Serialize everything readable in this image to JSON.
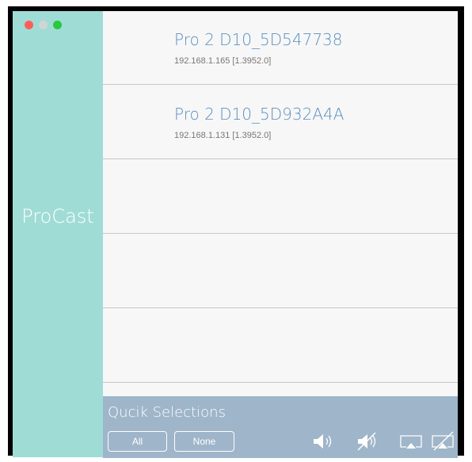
{
  "app": {
    "title": "ProCast"
  },
  "devices": [
    {
      "name": "Pro 2 D10_5D547738",
      "address": "192.168.1.165 [1.3952.0]"
    },
    {
      "name": "Pro 2 D10_5D932A4A",
      "address": "192.168.1.131 [1.3952.0]"
    }
  ],
  "quick_selections": {
    "title": "Qucik Selections",
    "all_label": "All",
    "none_label": "None"
  },
  "toolbar": {
    "icons": [
      "volume-on-icon",
      "mute-icon",
      "cast-screen-icon",
      "stop-cast-icon"
    ]
  },
  "colors": {
    "sidebar": "#a0dcd6",
    "device_name": "#5b8fc0",
    "bottom_bar": "#9fb5c9"
  }
}
